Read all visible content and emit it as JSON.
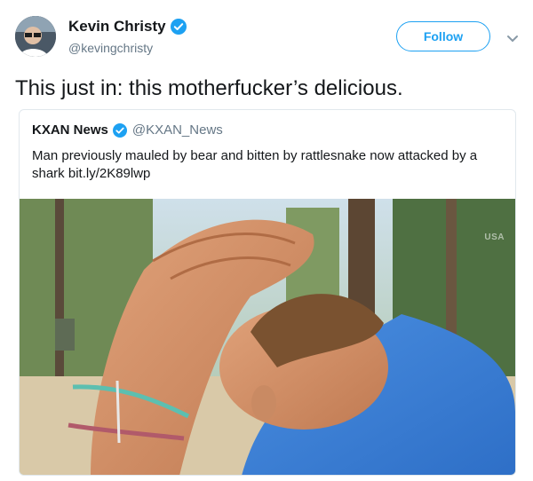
{
  "author": {
    "display_name": "Kevin Christy",
    "handle": "@kevingchristy",
    "verified": true
  },
  "actions": {
    "follow_label": "Follow"
  },
  "tweet": {
    "text": "This just in: this motherfucker’s delicious."
  },
  "quoted_tweet": {
    "display_name": "KXAN News",
    "handle": "@KXAN_News",
    "verified": true,
    "text": "Man previously mauled by bear and bitten by rattlesnake now attacked by a shark bit.ly/2K89lwp",
    "image_watermark": "USA"
  },
  "colors": {
    "brand_blue": "#1da1f2",
    "secondary_text": "#657786",
    "border": "#e1e8ed"
  },
  "icons": {
    "verified": "verified-badge-icon",
    "caret": "chevron-down-icon"
  }
}
